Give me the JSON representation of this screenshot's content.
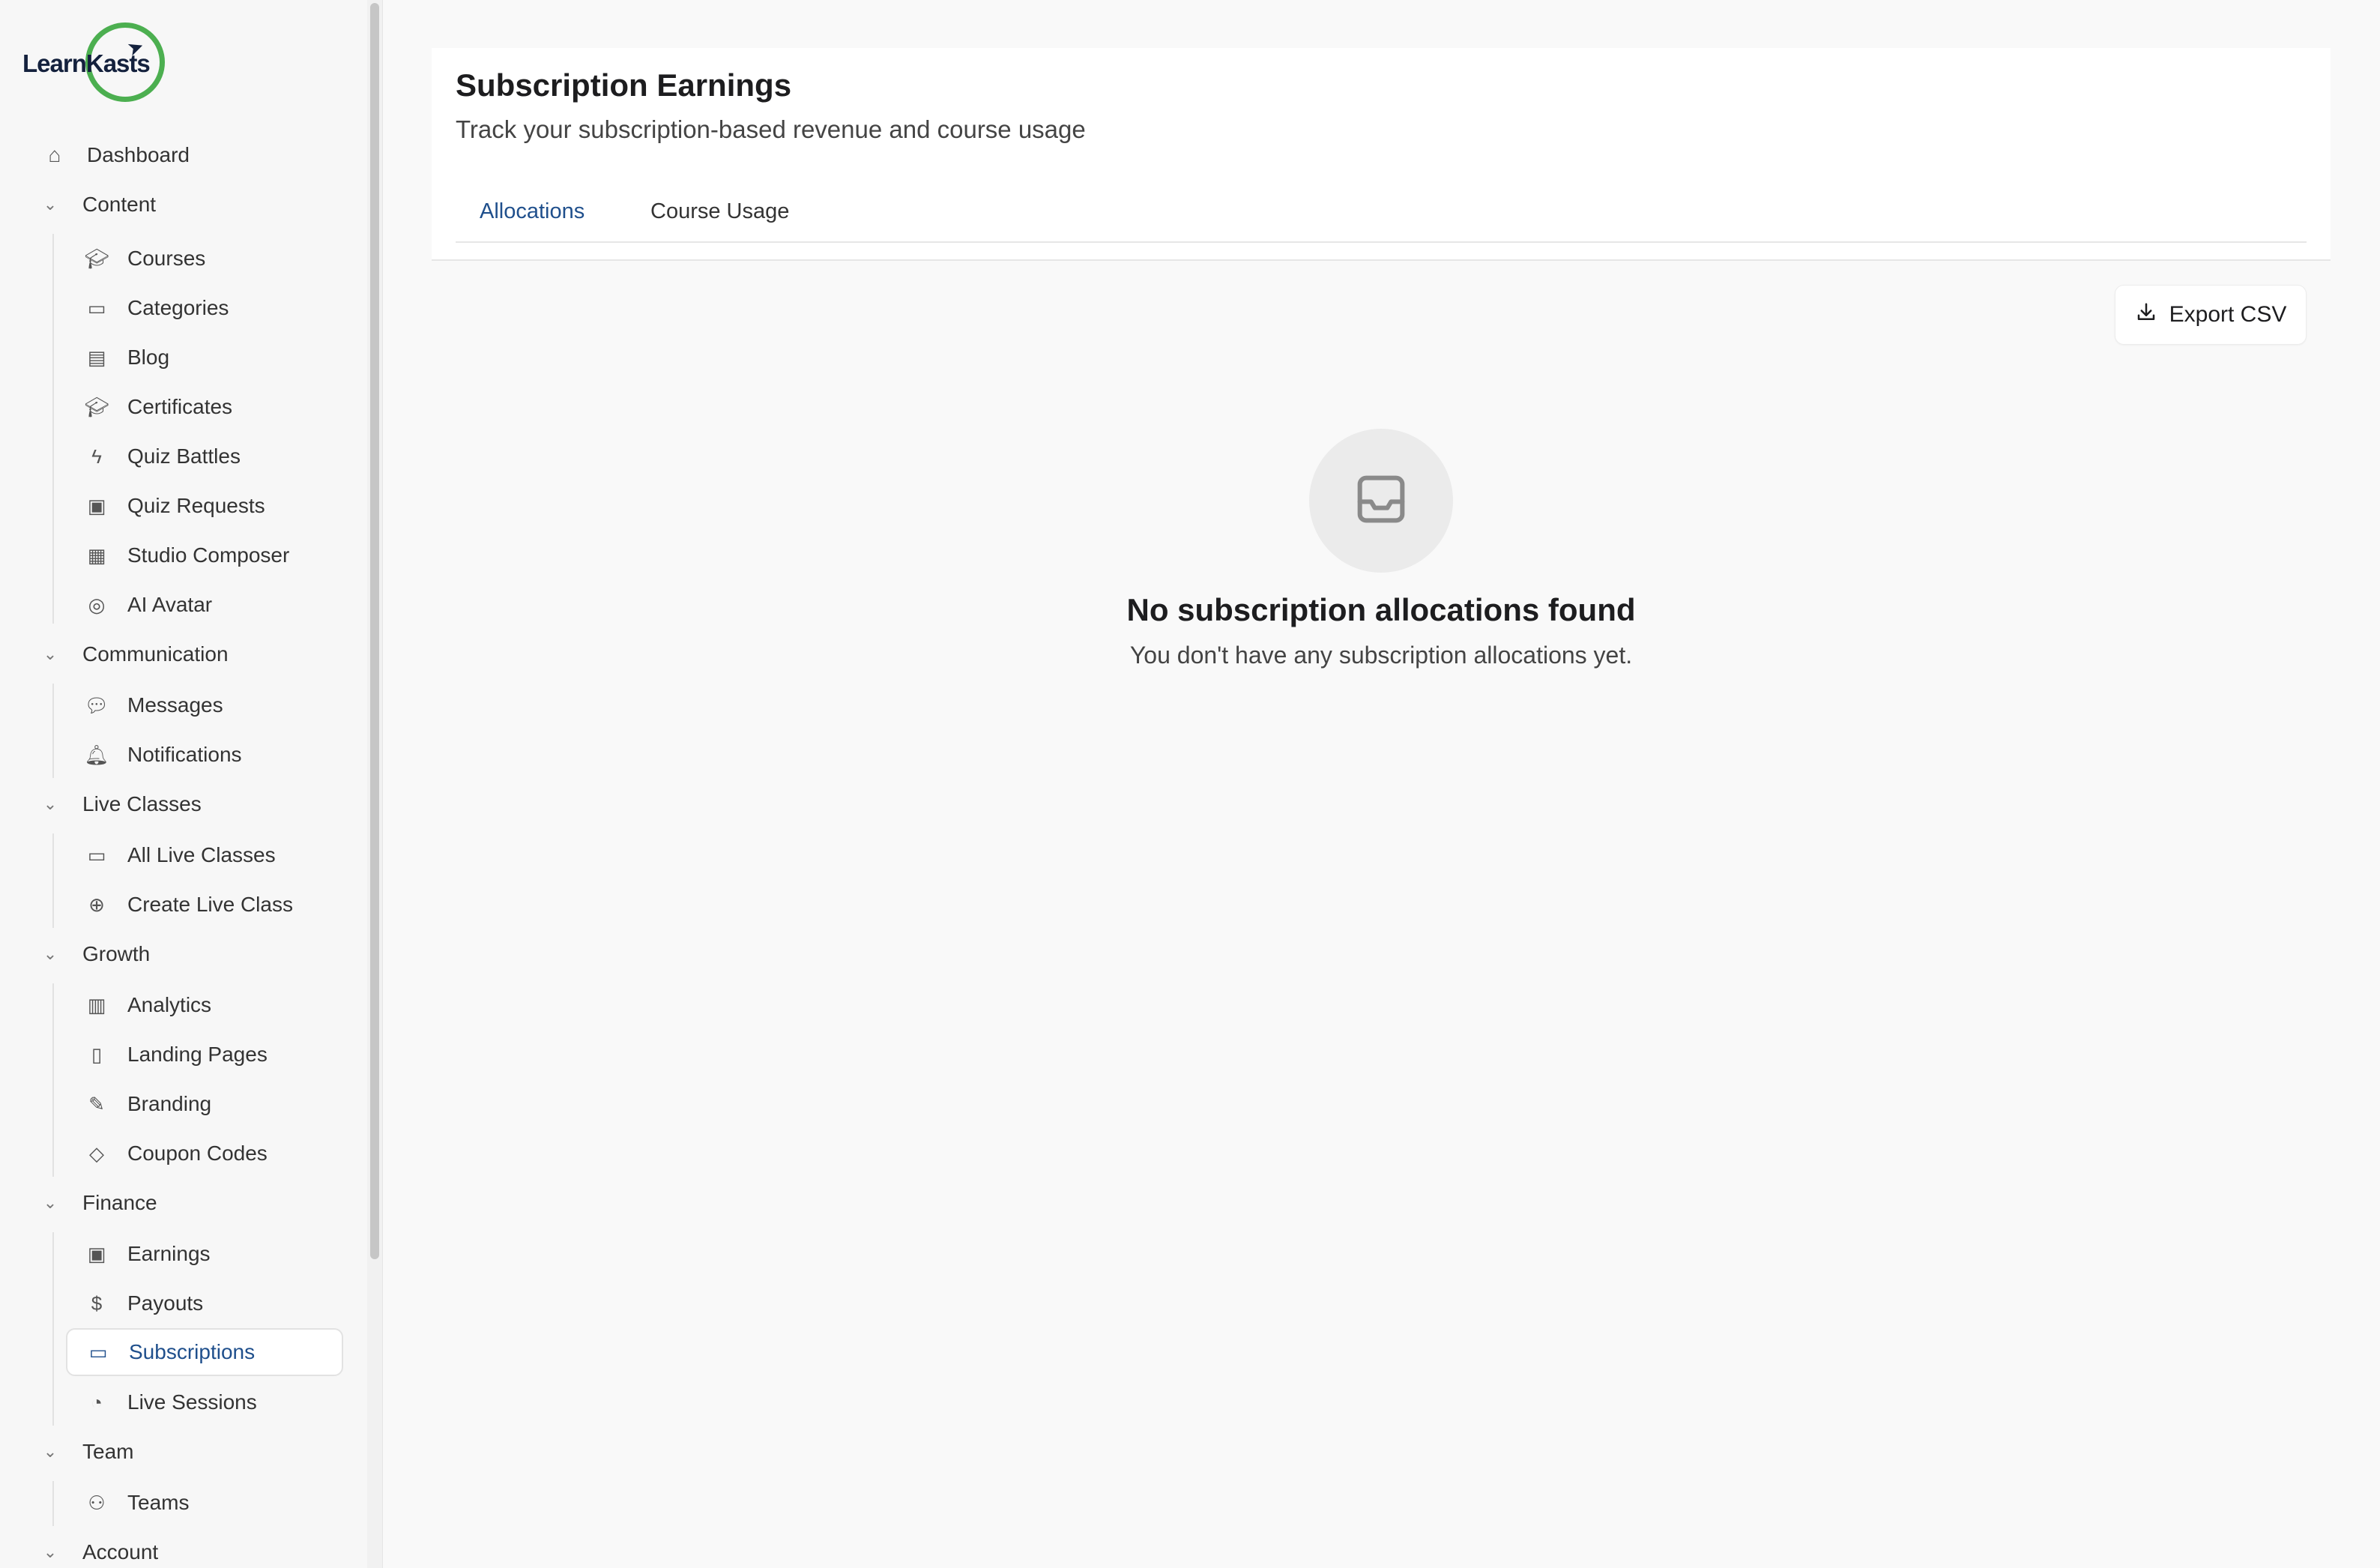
{
  "app": {
    "logo_text": "LearnKasts"
  },
  "sidebar": {
    "dashboard": {
      "label": "Dashboard",
      "icon": "home-icon"
    },
    "groups": [
      {
        "label": "Content",
        "items": [
          {
            "label": "Courses",
            "icon": "graduation-cap-icon"
          },
          {
            "label": "Categories",
            "icon": "folder-icon"
          },
          {
            "label": "Blog",
            "icon": "newspaper-icon"
          },
          {
            "label": "Certificates",
            "icon": "graduation-cap-icon"
          },
          {
            "label": "Quiz Battles",
            "icon": "lightning-icon"
          },
          {
            "label": "Quiz Requests",
            "icon": "clipboard-icon"
          },
          {
            "label": "Studio Composer",
            "icon": "film-icon"
          },
          {
            "label": "AI Avatar",
            "icon": "user-circle-icon"
          }
        ]
      },
      {
        "label": "Communication",
        "items": [
          {
            "label": "Messages",
            "icon": "chat-icon"
          },
          {
            "label": "Notifications",
            "icon": "bell-icon"
          }
        ]
      },
      {
        "label": "Live Classes",
        "items": [
          {
            "label": "All Live Classes",
            "icon": "video-icon"
          },
          {
            "label": "Create Live Class",
            "icon": "plus-circle-icon"
          }
        ]
      },
      {
        "label": "Growth",
        "items": [
          {
            "label": "Analytics",
            "icon": "bar-chart-icon"
          },
          {
            "label": "Landing Pages",
            "icon": "file-icon"
          },
          {
            "label": "Branding",
            "icon": "brush-icon"
          },
          {
            "label": "Coupon Codes",
            "icon": "tag-icon"
          }
        ]
      },
      {
        "label": "Finance",
        "items": [
          {
            "label": "Earnings",
            "icon": "banknote-icon"
          },
          {
            "label": "Payouts",
            "icon": "dollar-circle-icon"
          },
          {
            "label": "Subscriptions",
            "icon": "credit-card-icon",
            "active": true
          },
          {
            "label": "Live Sessions",
            "icon": "pie-chart-icon"
          }
        ]
      },
      {
        "label": "Team",
        "items": [
          {
            "label": "Teams",
            "icon": "users-icon"
          }
        ]
      },
      {
        "label": "Account",
        "items": []
      }
    ]
  },
  "header": {
    "title": "Subscription Earnings",
    "subtitle": "Track your subscription-based revenue and course usage"
  },
  "tabs": [
    {
      "label": "Allocations",
      "active": true
    },
    {
      "label": "Course Usage",
      "active": false
    }
  ],
  "toolbar": {
    "export_label": "Export CSV",
    "export_icon": "download-icon"
  },
  "empty_state": {
    "icon": "inbox-icon",
    "title": "No subscription allocations found",
    "description": "You don't have any subscription allocations yet."
  },
  "colors": {
    "accent": "#1f4f8c",
    "logo_ring": "#4caf50",
    "logo_text": "#14213d"
  }
}
